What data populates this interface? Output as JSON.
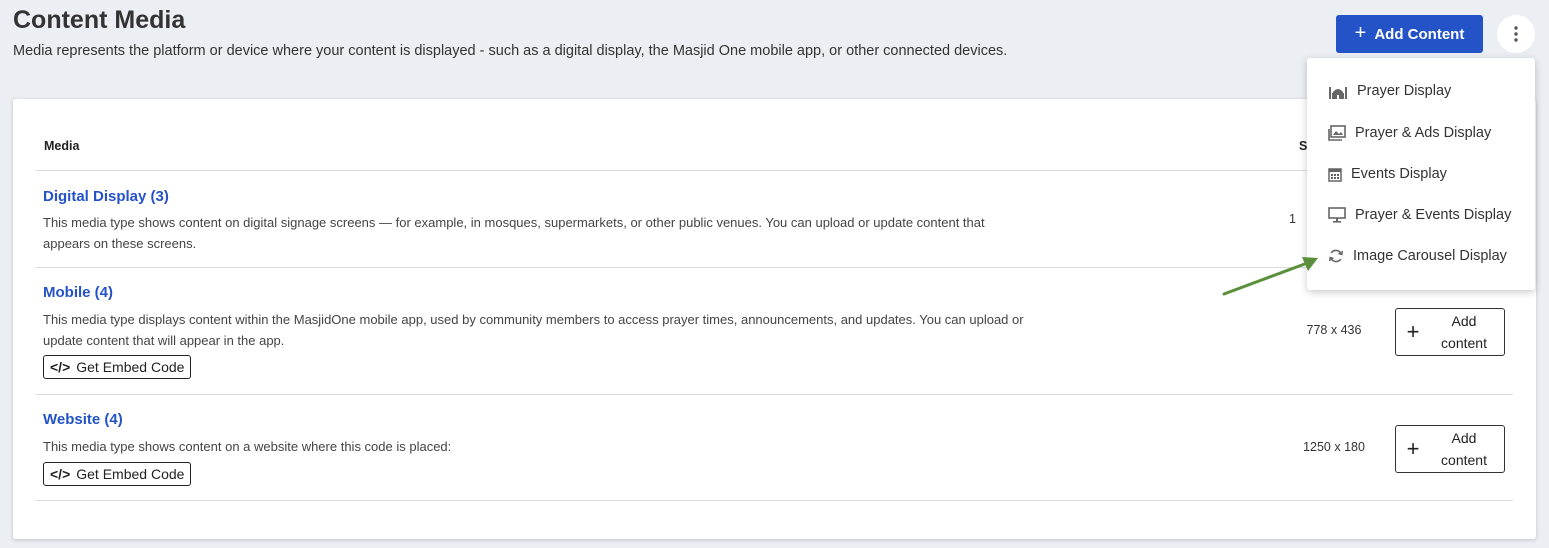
{
  "header": {
    "title": "Content Media",
    "subtitle": "Media represents the platform or device where your content is displayed - such as a digital display, the Masjid One mobile app, or other connected devices.",
    "add_content_label": "Add Content"
  },
  "table": {
    "columns": {
      "media": "Media",
      "size": "S"
    },
    "rows": [
      {
        "title": "Digital Display (3)",
        "description": "This media type shows content on digital signage screens — for example, in mosques, supermarkets, or other public venues. You can upload or update content that appears on these screens.",
        "size": "1"
      },
      {
        "title": "Mobile (4)",
        "description": "This media type displays content within the MasjidOne mobile app, used by community members to access prayer times, announcements, and updates. You can upload or update content that will appear in the app.",
        "embed_label": "Get Embed Code",
        "size": "778 x 436",
        "add_label": "Add content"
      },
      {
        "title": "Website (4)",
        "description": "This media type shows content on a website where this code is placed:",
        "embed_label": "Get Embed Code",
        "size": "1250 x 180",
        "add_label": "Add content"
      }
    ]
  },
  "dropdown": {
    "items": [
      {
        "label": "Prayer Display",
        "icon": "mosque-icon"
      },
      {
        "label": "Prayer & Ads Display",
        "icon": "images-icon"
      },
      {
        "label": "Events Display",
        "icon": "calendar-icon"
      },
      {
        "label": "Prayer & Events Display",
        "icon": "monitor-icon"
      },
      {
        "label": "Image Carousel Display",
        "icon": "refresh-icon"
      }
    ]
  },
  "colors": {
    "accent": "#2453c7",
    "background": "#ebeef3",
    "annotation_arrow": "#5a8f3c"
  }
}
